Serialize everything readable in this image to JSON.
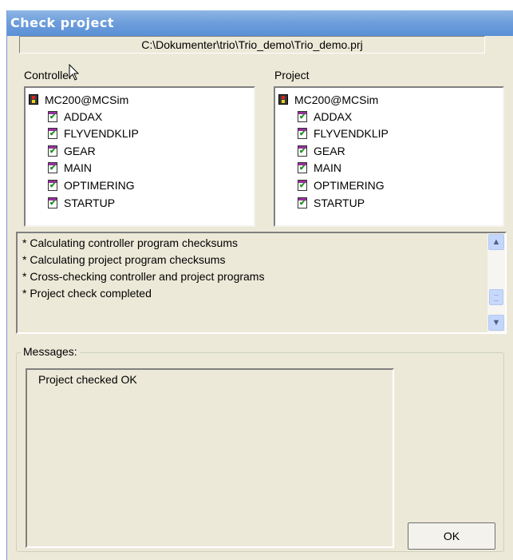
{
  "window": {
    "title": "Check project"
  },
  "project_path": "C:\\Dokumenter\\trio\\Trio_demo\\Trio_demo.prj",
  "controller_panel": {
    "label": "Controller",
    "root": "MC200@MCSim",
    "programs": [
      "ADDAX",
      "FLYVENDKLIP",
      "GEAR",
      "MAIN",
      "OPTIMERING",
      "STARTUP"
    ]
  },
  "project_panel": {
    "label": "Project",
    "root": "MC200@MCSim",
    "programs": [
      "ADDAX",
      "FLYVENDKLIP",
      "GEAR",
      "MAIN",
      "OPTIMERING",
      "STARTUP"
    ]
  },
  "log": {
    "lines": [
      "* Calculating controller program checksums",
      "* Calculating project program checksums",
      "* Cross-checking controller and project programs",
      "* Project check completed"
    ]
  },
  "messages": {
    "label": "Messages:",
    "text": "Project checked OK"
  },
  "buttons": {
    "ok": "OK"
  },
  "icons": {
    "controller": "controller-icon",
    "program": "program-checked-icon",
    "scroll_up": "scroll-up-icon",
    "scroll_down": "scroll-down-icon",
    "cursor": "mouse-cursor-icon"
  }
}
